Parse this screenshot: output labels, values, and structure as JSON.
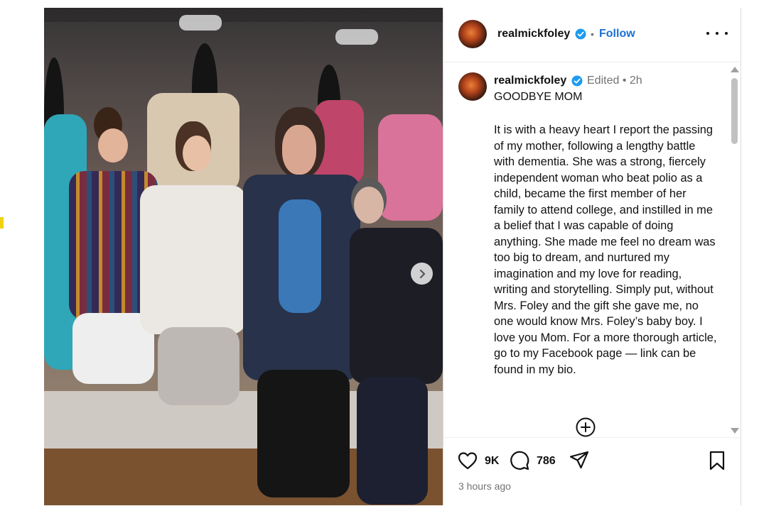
{
  "post": {
    "username": "realmickfoley",
    "follow_label": "Follow",
    "header_separator": "•",
    "caption": {
      "username": "realmickfoley",
      "edited": "Edited",
      "separator": "•",
      "age": "2h",
      "title": "GOODBYE MOM",
      "body": "It is with a heavy heart I report the passing of my mother, following a lengthy battle with dementia. She was a strong, fiercely independent woman who beat polio as a child, became the first member of her family to attend college, and instilled in me a belief that I was capable of doing anything. She made me feel no dream was too big to dream, and nurtured my imagination and my love for reading, writing and storytelling. Simply put, without Mrs. Foley and the gift she gave me, no one would know Mrs. Foley’s baby boy. I love you Mom. For a more thorough article, go to my Facebook page — link can be found in my bio."
    },
    "likes": "9K",
    "comments": "786",
    "timestamp": "3 hours ago"
  },
  "icons": {
    "next": "chevron-right-icon",
    "verified": "verified-badge-icon",
    "more": "more-options-icon",
    "add": "add-circle-icon",
    "like": "heart-icon",
    "comment": "comment-icon",
    "share": "share-icon",
    "save": "bookmark-icon"
  },
  "colors": {
    "accent": "#1a6fd6",
    "verified": "#1d9bf0",
    "muted": "#737373",
    "text": "#111111"
  }
}
